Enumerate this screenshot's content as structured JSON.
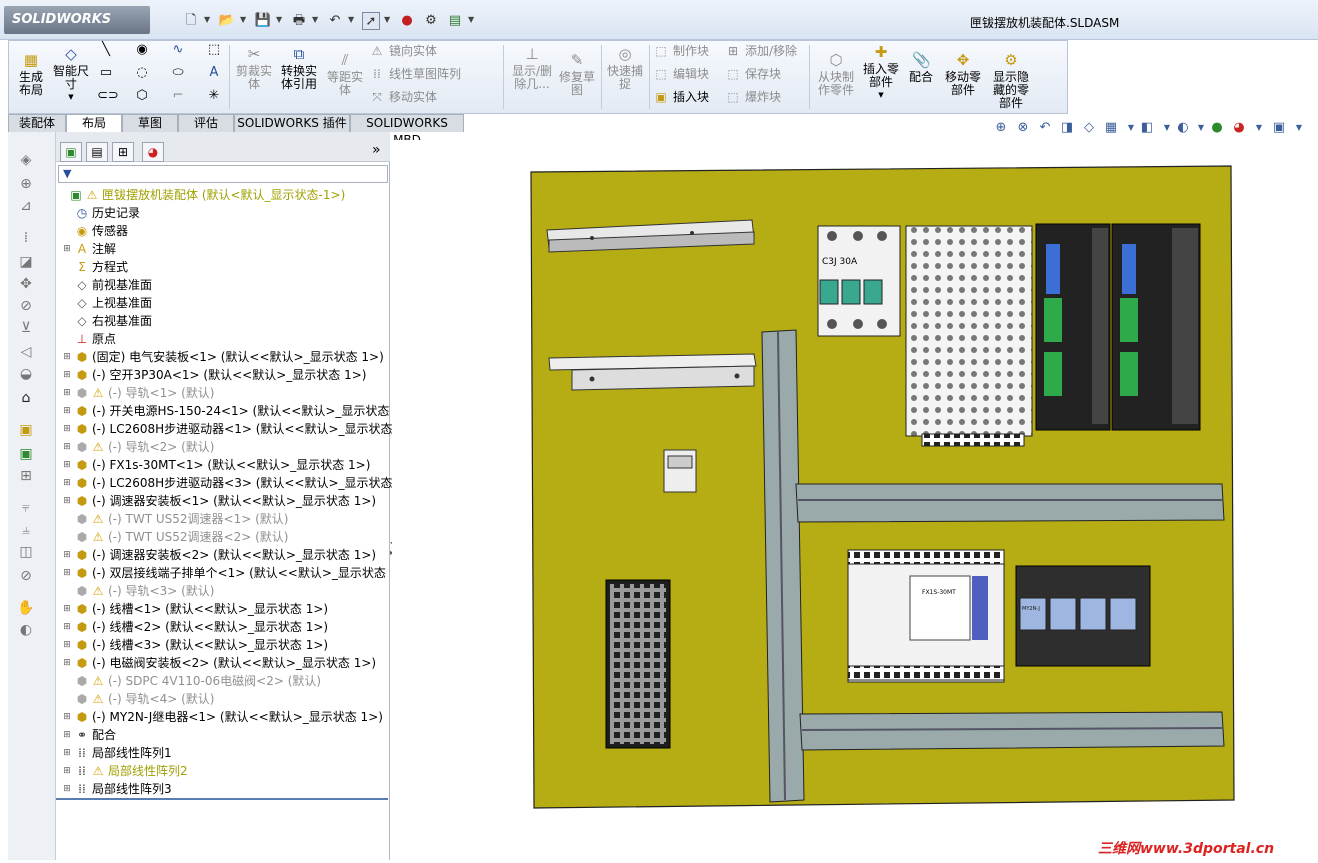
{
  "app": {
    "logo_text": "SOLIDWORKS",
    "document_title": "匣钹摆放机装配体.SLDASM"
  },
  "quick_access": {
    "icons": [
      "new-icon",
      "open-icon",
      "save-icon",
      "print-icon",
      "undo-icon",
      "select-icon",
      "traffic-light-icon",
      "options-icon",
      "view-options-icon"
    ]
  },
  "ribbon": {
    "generate_layout": "生成\n布局",
    "smart_dimension": "智能尺\n寸",
    "trim": "剪裁实\n体",
    "convert": "转换实\n体引用",
    "offset": "等距实\n体",
    "mirror": "镜向实体",
    "linear_pattern": "线性草图阵列",
    "move": "移动实体",
    "show_delete": "显示/删\n除几...",
    "repair": "修复草\n图",
    "quick_snap": "快速捕\n捉",
    "make_block": "制作块",
    "edit_block": "编辑块",
    "insert_block": "插入块",
    "add_remove": "添加/移除",
    "save_block": "保存块",
    "explode_block": "爆炸块",
    "from_block": "从块制\n作零件",
    "insert_part": "插入零\n部件",
    "mate": "配合",
    "move_part": "移动零\n部件",
    "show_hidden": "显示隐\n藏的零\n部件"
  },
  "tabs": [
    "装配体",
    "布局",
    "草图",
    "评估",
    "SOLIDWORKS 插件",
    "SOLIDWORKS MBD"
  ],
  "active_tab": "布局",
  "panel": {
    "collapse_label": "»",
    "filter_icon": "filter-icon",
    "tree": [
      {
        "label": "匣钹摆放机装配体  (默认<默认_显示状态-1>)",
        "level": 0,
        "style": "warn-root",
        "exp": "",
        "icon": "assembly-icon"
      },
      {
        "label": "历史记录",
        "level": 1,
        "style": "",
        "exp": "",
        "icon": "history-icon"
      },
      {
        "label": "传感器",
        "level": 1,
        "style": "",
        "exp": "",
        "icon": "sensor-icon"
      },
      {
        "label": "注解",
        "level": 1,
        "style": "",
        "exp": "+",
        "icon": "annotation-icon"
      },
      {
        "label": "方程式",
        "level": 1,
        "style": "",
        "exp": "",
        "icon": "equation-icon"
      },
      {
        "label": "前视基准面",
        "level": 1,
        "style": "",
        "exp": "",
        "icon": "plane-icon"
      },
      {
        "label": "上视基准面",
        "level": 1,
        "style": "",
        "exp": "",
        "icon": "plane-icon"
      },
      {
        "label": "右视基准面",
        "level": 1,
        "style": "",
        "exp": "",
        "icon": "plane-icon"
      },
      {
        "label": "原点",
        "level": 1,
        "style": "",
        "exp": "",
        "icon": "origin-icon"
      },
      {
        "label": "(固定) 电气安装板<1> (默认<<默认>_显示状态 1>)",
        "level": 1,
        "style": "",
        "exp": "+",
        "icon": "part-icon"
      },
      {
        "label": "(-) 空开3P30A<1> (默认<<默认>_显示状态 1>)",
        "level": 1,
        "style": "",
        "exp": "+",
        "icon": "part-icon"
      },
      {
        "label": "(-) 导轨<1> (默认)",
        "level": 1,
        "style": "grey",
        "exp": "+",
        "icon": "part-warn-icon"
      },
      {
        "label": "(-) 开关电源HS-150-24<1> (默认<<默认>_显示状态",
        "level": 1,
        "style": "",
        "exp": "+",
        "icon": "part-icon"
      },
      {
        "label": "(-) LC2608H步进驱动器<1> (默认<<默认>_显示状态",
        "level": 1,
        "style": "",
        "exp": "+",
        "icon": "part-icon"
      },
      {
        "label": "(-) 导轨<2> (默认)",
        "level": 1,
        "style": "grey",
        "exp": "+",
        "icon": "part-warn-icon"
      },
      {
        "label": "(-) FX1s-30MT<1> (默认<<默认>_显示状态 1>)",
        "level": 1,
        "style": "",
        "exp": "+",
        "icon": "part-icon"
      },
      {
        "label": "(-) LC2608H步进驱动器<3> (默认<<默认>_显示状态",
        "level": 1,
        "style": "",
        "exp": "+",
        "icon": "part-icon"
      },
      {
        "label": "(-) 调速器安装板<1> (默认<<默认>_显示状态 1>)",
        "level": 1,
        "style": "",
        "exp": "+",
        "icon": "part-icon"
      },
      {
        "label": "(-) TWT US52调速器<1> (默认)",
        "level": 1,
        "style": "grey",
        "exp": "",
        "icon": "part-warn-icon"
      },
      {
        "label": "(-) TWT US52调速器<2> (默认)",
        "level": 1,
        "style": "grey",
        "exp": "",
        "icon": "part-warn-icon"
      },
      {
        "label": "(-) 调速器安装板<2> (默认<<默认>_显示状态 1>)",
        "level": 1,
        "style": "",
        "exp": "+",
        "icon": "part-icon"
      },
      {
        "label": "(-) 双层接线端子排单个<1> (默认<<默认>_显示状态",
        "level": 1,
        "style": "",
        "exp": "+",
        "icon": "part-icon"
      },
      {
        "label": "(-) 导轨<3> (默认)",
        "level": 1,
        "style": "grey",
        "exp": "",
        "icon": "part-warn-icon"
      },
      {
        "label": "(-) 线槽<1> (默认<<默认>_显示状态 1>)",
        "level": 1,
        "style": "",
        "exp": "+",
        "icon": "part-icon"
      },
      {
        "label": "(-) 线槽<2> (默认<<默认>_显示状态 1>)",
        "level": 1,
        "style": "",
        "exp": "+",
        "icon": "part-icon"
      },
      {
        "label": "(-) 线槽<3> (默认<<默认>_显示状态 1>)",
        "level": 1,
        "style": "",
        "exp": "+",
        "icon": "part-icon"
      },
      {
        "label": "(-) 电磁阀安装板<2> (默认<<默认>_显示状态 1>)",
        "level": 1,
        "style": "",
        "exp": "+",
        "icon": "part-icon"
      },
      {
        "label": "(-) SDPC 4V110-06电磁阀<2> (默认)",
        "level": 1,
        "style": "grey",
        "exp": "",
        "icon": "part-warn-icon"
      },
      {
        "label": "(-) 导轨<4> (默认)",
        "level": 1,
        "style": "grey",
        "exp": "",
        "icon": "part-warn-icon"
      },
      {
        "label": "(-) MY2N-J继电器<1> (默认<<默认>_显示状态 1>)",
        "level": 1,
        "style": "",
        "exp": "+",
        "icon": "part-icon"
      },
      {
        "label": "配合",
        "level": 1,
        "style": "",
        "exp": "+",
        "icon": "mate-icon"
      },
      {
        "label": "局部线性阵列1",
        "level": 1,
        "style": "",
        "exp": "+",
        "icon": "pattern-icon"
      },
      {
        "label": "局部线性阵列2",
        "level": 1,
        "style": "warn",
        "exp": "+",
        "icon": "pattern-warn-icon"
      },
      {
        "label": "局部线性阵列3",
        "level": 1,
        "style": "",
        "exp": "+",
        "icon": "pattern-icon"
      }
    ]
  },
  "model": {
    "breaker_label": "C3J 30A",
    "plc_label_1": "FX1S-30MT",
    "relay_label": "MY2N-J"
  },
  "watermark": "三维网www.3dportal.cn"
}
